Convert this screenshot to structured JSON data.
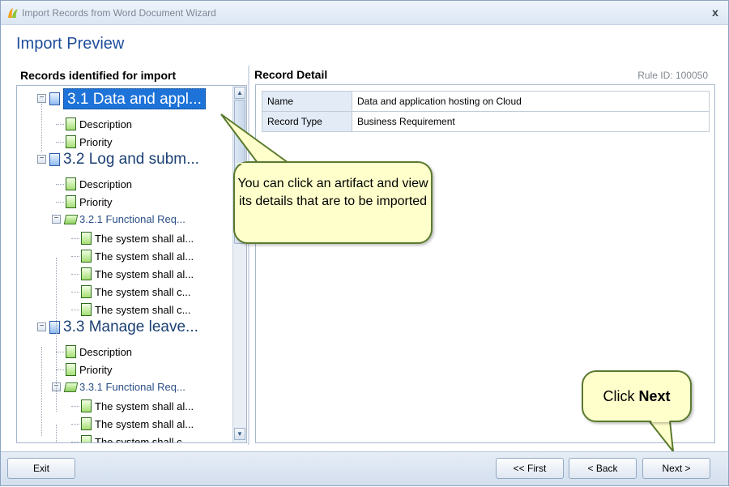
{
  "window": {
    "title": "Import Records from Word Document Wizard",
    "close_glyph": "x"
  },
  "page_title": "Import Preview",
  "left_panel": {
    "header": "Records identified for import",
    "tree": [
      {
        "label": "3.1 Data and appl...",
        "style": "big",
        "selected": true,
        "icon": "blue-doc-icon",
        "expander": "−"
      },
      {
        "label": "Description",
        "style": "small",
        "icon": "green-doc-icon"
      },
      {
        "label": "Priority",
        "style": "small",
        "icon": "green-doc-icon"
      },
      {
        "label": "3.2 Log and subm...",
        "style": "big",
        "icon": "blue-doc-icon",
        "expander": "−"
      },
      {
        "label": "Description",
        "style": "small",
        "icon": "green-doc-icon"
      },
      {
        "label": "Priority",
        "style": "small",
        "icon": "green-doc-icon"
      },
      {
        "label": "3.2.1 Functional Req...",
        "style": "mid",
        "icon": "green-folder-icon",
        "expander": "−"
      },
      {
        "label": "The system shall al...",
        "style": "small",
        "icon": "green-doc-icon"
      },
      {
        "label": "The system shall al...",
        "style": "small",
        "icon": "green-doc-icon"
      },
      {
        "label": "The system shall al...",
        "style": "small",
        "icon": "green-doc-icon"
      },
      {
        "label": "The system shall c...",
        "style": "small",
        "icon": "green-doc-icon"
      },
      {
        "label": "The system shall c...",
        "style": "small",
        "icon": "green-doc-icon"
      },
      {
        "label": "3.3 Manage leave...",
        "style": "big",
        "icon": "blue-doc-icon",
        "expander": "−"
      },
      {
        "label": "Description",
        "style": "small",
        "icon": "green-doc-icon"
      },
      {
        "label": "Priority",
        "style": "small",
        "icon": "green-doc-icon"
      },
      {
        "label": "3.3.1 Functional Req...",
        "style": "mid",
        "icon": "green-folder-icon",
        "expander": "−"
      },
      {
        "label": "The system shall al...",
        "style": "small",
        "icon": "green-doc-icon"
      },
      {
        "label": "The system shall al...",
        "style": "small",
        "icon": "green-doc-icon"
      },
      {
        "label": "The system shall c...",
        "style": "small",
        "icon": "green-doc-icon"
      }
    ],
    "scroll_up_glyph": "▲",
    "scroll_down_glyph": "▼"
  },
  "right_panel": {
    "header": "Record Detail",
    "rule_id": "Rule ID: 100050",
    "details": [
      {
        "key": "Name",
        "value": "Data and application hosting on Cloud"
      },
      {
        "key": "Record Type",
        "value": "Business Requirement"
      }
    ]
  },
  "callouts": {
    "artifact_tip": "You can click an artifact and view its details that are to be imported",
    "next_tip_prefix": "Click ",
    "next_tip_bold": "Next"
  },
  "footer": {
    "exit_label": "Exit",
    "first_label": "<< First",
    "back_label": "< Back",
    "next_label": "Next >"
  },
  "colors": {
    "title_blue": "#1e4e9b",
    "selection_blue": "#1d73d8",
    "callout_fill": "#ffffcc",
    "callout_border": "#5a7a2e"
  }
}
